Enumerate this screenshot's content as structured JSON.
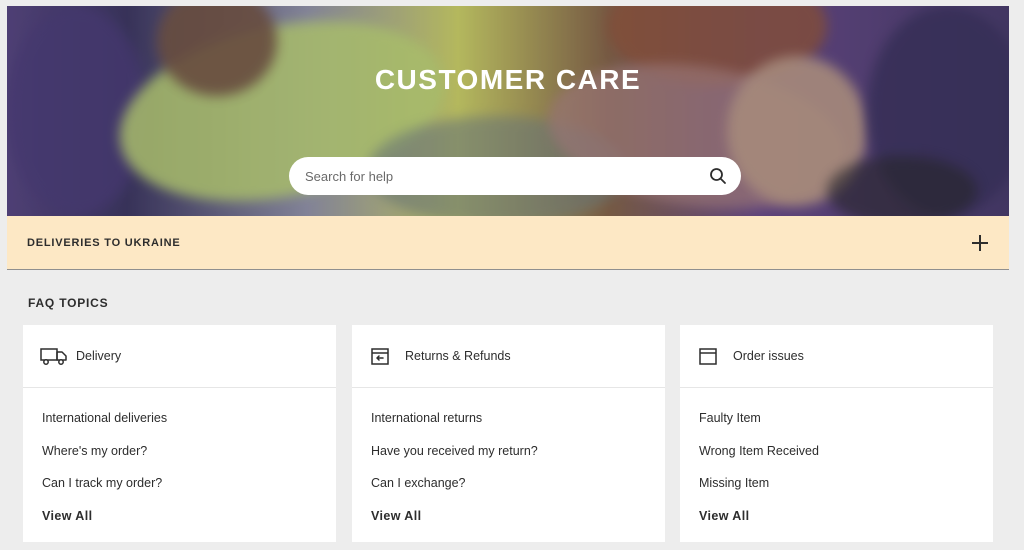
{
  "hero": {
    "title": "CUSTOMER CARE",
    "search_placeholder": "Search for help",
    "search_icon": "search-icon"
  },
  "notice": {
    "title": "DELIVERIES TO UKRAINE",
    "expand_icon": "plus-icon"
  },
  "faq": {
    "heading": "FAQ TOPICS",
    "cards": [
      {
        "icon": "truck-icon",
        "title": "Delivery",
        "links": [
          "International deliveries",
          "Where's my order?",
          "Can I track my order?"
        ],
        "view_all": "View All"
      },
      {
        "icon": "return-box-icon",
        "title": "Returns & Refunds",
        "links": [
          "International returns",
          "Have you received my return?",
          "Can I exchange?"
        ],
        "view_all": "View All"
      },
      {
        "icon": "package-icon",
        "title": "Order issues",
        "links": [
          "Faulty Item",
          "Wrong Item Received",
          "Missing Item"
        ],
        "view_all": "View All"
      }
    ]
  },
  "colors": {
    "page_background": "#ededed",
    "notice_background": "#fde8c5",
    "card_background": "#ffffff",
    "text": "#2d2d2d"
  }
}
